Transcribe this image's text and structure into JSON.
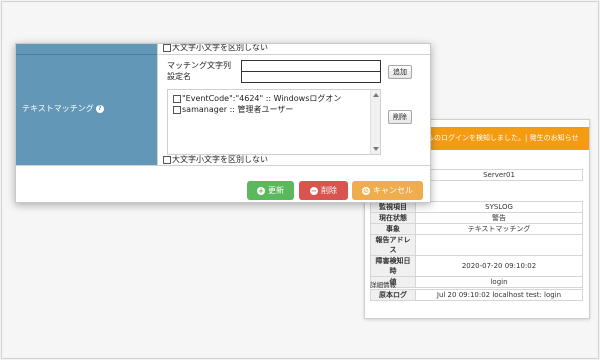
{
  "notification": {
    "header": "ルのログインを検知しました。| 発生のお知らせ",
    "host_row": {
      "key": "",
      "value": "Server01"
    },
    "rows": [
      {
        "key": "監視項目",
        "value": "SYSLOG"
      },
      {
        "key": "現在状態",
        "value": "警告"
      },
      {
        "key": "事象",
        "value": "テキストマッチング"
      },
      {
        "key": "報告アドレス",
        "value": ""
      },
      {
        "key": "障害検知日時",
        "value": "2020-07-20 09:10:02"
      },
      {
        "key": "値",
        "value": "login"
      }
    ],
    "detail_title": "詳細情報",
    "detail_row": {
      "key": "原本ログ",
      "value": "Jul 20 09:10:02 localhost test: login"
    }
  },
  "dialog": {
    "cut_checkbox_label": "大文字小文字を区別しない",
    "section_label": "テキストマッチング",
    "matching_label": "マッチング文字列",
    "setting_name_label": "設定名",
    "matching_value": "",
    "setting_name_value": "",
    "add_button": "追加",
    "delete_small_button": "削除",
    "list_items": [
      "\"EventCode\":\"4624\" :: Windowsログオン",
      "samanager :: 管理者ユーザー"
    ],
    "case_checkbox_label": "大文字小文字を区別しない",
    "buttons": {
      "update": "更新",
      "delete": "削除",
      "cancel": "キャンセル"
    }
  },
  "colors": {
    "label_cell": "#6397b8",
    "notification_header": "#f39c12",
    "update": "#5cb85c",
    "delete": "#d9534f",
    "cancel": "#f0ad4e"
  }
}
